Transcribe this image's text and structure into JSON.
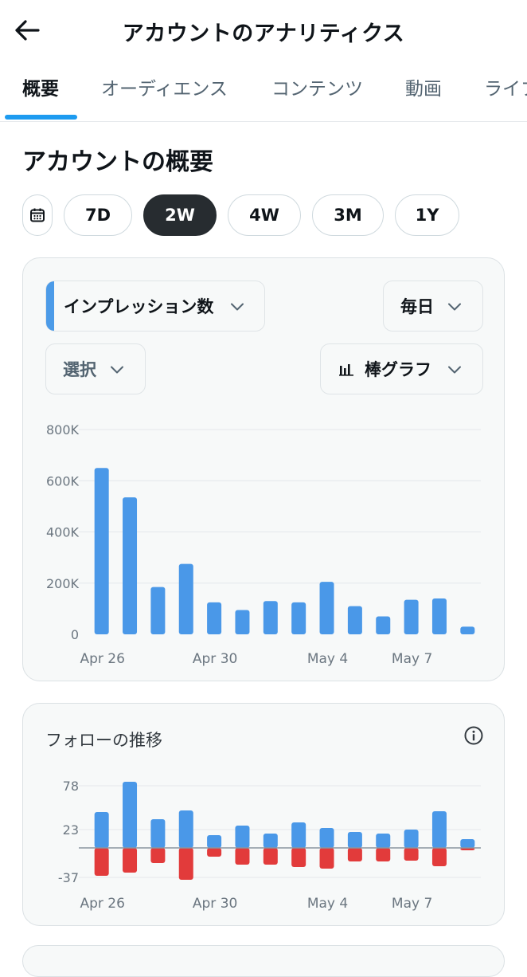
{
  "header": {
    "title": "アカウントのアナリティクス",
    "back_icon": "arrow-left-icon"
  },
  "tabs": [
    {
      "label": "概要",
      "active": true
    },
    {
      "label": "オーディエンス",
      "active": false
    },
    {
      "label": "コンテンツ",
      "active": false
    },
    {
      "label": "動画",
      "active": false
    },
    {
      "label": "ライブ",
      "active": false
    }
  ],
  "section": {
    "title": "アカウントの概要"
  },
  "range": {
    "calendar_icon": "calendar-icon",
    "options": [
      "7D",
      "2W",
      "4W",
      "3M",
      "1Y"
    ],
    "selected": "2W"
  },
  "impressions_card": {
    "metric_select": "インプレッション数",
    "interval_select": "毎日",
    "compare_select": "選択",
    "chart_type_select": "棒グラフ",
    "chart_type_icon": "bar-chart-icon"
  },
  "follow_card": {
    "title": "フォローの推移",
    "info_icon": "info-icon"
  },
  "colors": {
    "accent": "#1d9bf0",
    "bar_blue": "#4a98e8",
    "bar_red": "#e23b3b",
    "pill_active": "#272c30"
  },
  "chart_data": [
    {
      "type": "bar",
      "categories": [
        "Apr 26",
        "Apr 27",
        "Apr 28",
        "Apr 29",
        "Apr 30",
        "May 1",
        "May 2",
        "May 3",
        "May 4",
        "May 5",
        "May 6",
        "May 7",
        "May 8",
        "May 9"
      ],
      "values": [
        650000,
        535000,
        185000,
        275000,
        125000,
        95000,
        130000,
        125000,
        205000,
        110000,
        70000,
        135000,
        140000,
        30000
      ],
      "yticks": [
        "800K",
        "600K",
        "400K",
        "200K",
        "0"
      ],
      "ytick_values": [
        800000,
        600000,
        400000,
        200000,
        0
      ],
      "xtick_labels": [
        "Apr 26",
        "Apr 30",
        "May 4",
        "May 7"
      ],
      "xtick_indices": [
        0,
        4,
        8,
        11
      ],
      "ylim": [
        0,
        800000
      ],
      "grid": true
    },
    {
      "type": "bar",
      "categories": [
        "Apr 26",
        "Apr 27",
        "Apr 28",
        "Apr 29",
        "Apr 30",
        "May 1",
        "May 2",
        "May 3",
        "May 4",
        "May 5",
        "May 6",
        "May 7",
        "May 8",
        "May 9"
      ],
      "series": [
        {
          "values": [
            45,
            83,
            36,
            47,
            16,
            28,
            18,
            32,
            25,
            20,
            18,
            23,
            46,
            11
          ]
        },
        {
          "values": [
            -35,
            -31,
            -19,
            -40,
            -11,
            -21,
            -21,
            -24,
            -26,
            -17,
            -17,
            -16,
            -23,
            -3
          ]
        }
      ],
      "yticks": [
        "78",
        "23",
        "-37"
      ],
      "ytick_values": [
        78,
        23,
        -37
      ],
      "xtick_labels": [
        "Apr 26",
        "Apr 30",
        "May 4",
        "May 7"
      ],
      "xtick_indices": [
        0,
        4,
        8,
        11
      ],
      "ylim": [
        -40,
        86
      ],
      "grid": true
    }
  ]
}
